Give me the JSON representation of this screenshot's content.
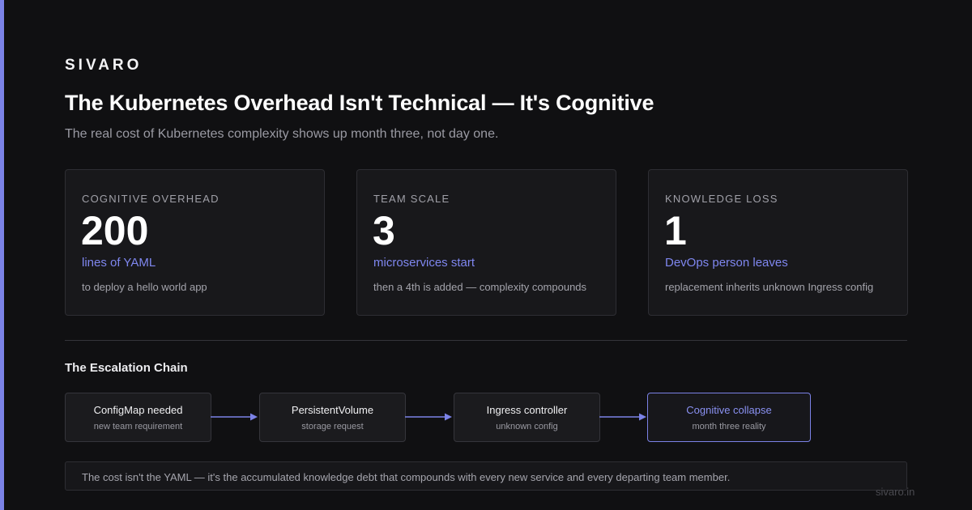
{
  "brand": "SIVARO",
  "title": "The Kubernetes Overhead Isn't Technical — It's Cognitive",
  "subtitle": "The real cost of Kubernetes complexity shows up month three, not day one.",
  "cards": [
    {
      "label": "COGNITIVE OVERHEAD",
      "value": "200",
      "unit": "lines of YAML",
      "note": "to deploy a hello world app"
    },
    {
      "label": "TEAM SCALE",
      "value": "3",
      "unit": "microservices start",
      "note": "then a 4th is added — complexity compounds"
    },
    {
      "label": "KNOWLEDGE LOSS",
      "value": "1",
      "unit": "DevOps person leaves",
      "note": "replacement inherits unknown Ingress config"
    }
  ],
  "chain": {
    "title": "The Escalation Chain",
    "steps": [
      {
        "title": "ConfigMap needed",
        "subtitle": "new team requirement"
      },
      {
        "title": "PersistentVolume",
        "subtitle": "storage request"
      },
      {
        "title": "Ingress controller",
        "subtitle": "unknown config"
      },
      {
        "title": "Cognitive collapse",
        "subtitle": "month three reality"
      }
    ]
  },
  "footer": "The cost isn't the YAML — it's the accumulated knowledge debt that compounds with every new service and every departing team member.",
  "domain": "sivaro.in",
  "colors": {
    "accent": "#7b82e6",
    "background": "#101012",
    "card": "#18181b"
  }
}
